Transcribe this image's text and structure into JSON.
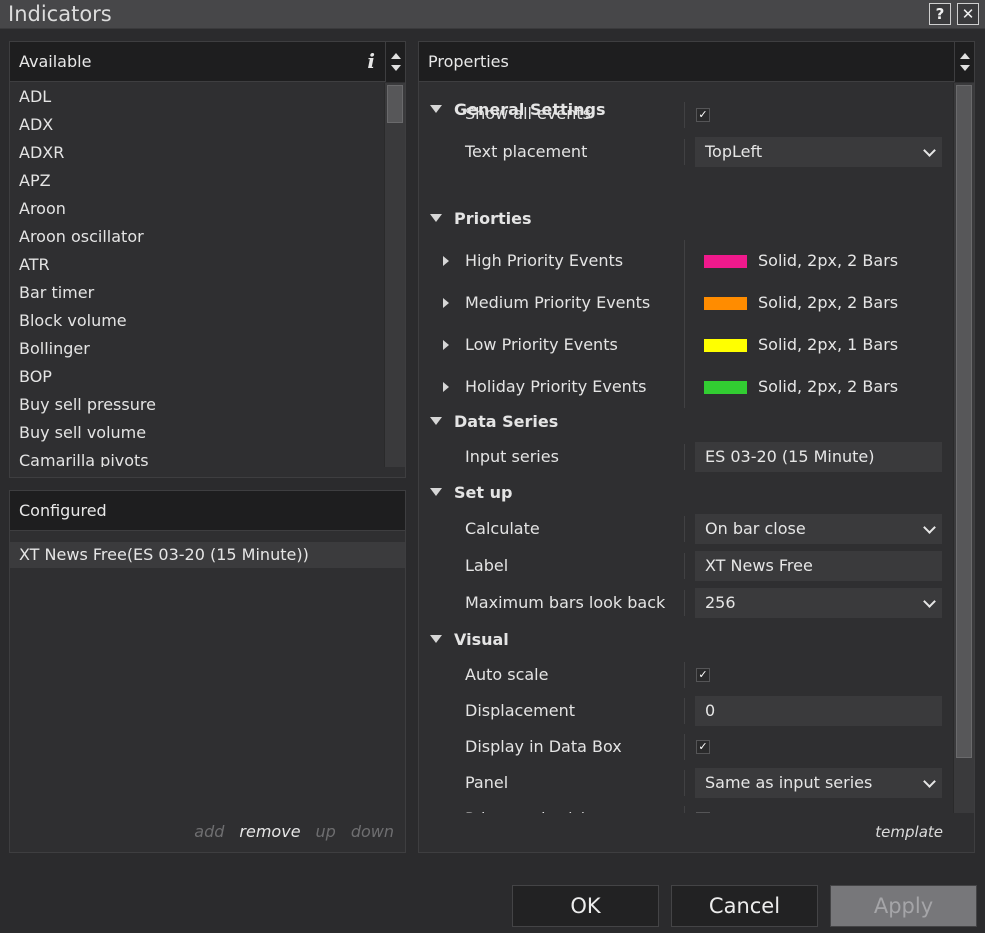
{
  "window": {
    "title": "Indicators",
    "help_label": "?",
    "close_label": "✕"
  },
  "available": {
    "header": "Available",
    "info_label": "i",
    "items": [
      "ADL",
      "ADX",
      "ADXR",
      "APZ",
      "Aroon",
      "Aroon oscillator",
      "ATR",
      "Bar timer",
      "Block volume",
      "Bollinger",
      "BOP",
      "Buy sell pressure",
      "Buy sell volume",
      "Camarilla pivots"
    ]
  },
  "configured": {
    "header": "Configured",
    "items": [
      "XT News Free(ES 03-20 (15 Minute))"
    ],
    "actions": {
      "add": "add",
      "remove": "remove",
      "up": "up",
      "down": "down"
    }
  },
  "properties": {
    "header": "Properties",
    "template_label": "template",
    "general": {
      "title": "General Settings",
      "show_all_events": {
        "label": "Show all events",
        "checked": true
      },
      "text_placement": {
        "label": "Text placement",
        "value": "TopLeft"
      }
    },
    "priorities": {
      "title": "Priorties",
      "items": [
        {
          "label": "High Priority Events",
          "color": "#f0198c",
          "value": "Solid, 2px, 2 Bars"
        },
        {
          "label": "Medium Priority Events",
          "color": "#ff8c00",
          "value": "Solid, 2px, 2 Bars"
        },
        {
          "label": "Low Priority Events",
          "color": "#ffff00",
          "value": "Solid, 2px, 1 Bars"
        },
        {
          "label": "Holiday Priority Events",
          "color": "#32cd32",
          "value": "Solid, 2px, 2 Bars"
        }
      ]
    },
    "data_series": {
      "title": "Data Series",
      "input_series": {
        "label": "Input series",
        "value": "ES 03-20 (15 Minute)"
      }
    },
    "setup": {
      "title": "Set up",
      "calculate": {
        "label": "Calculate",
        "value": "On bar close"
      },
      "label": {
        "label": "Label",
        "value": "XT News Free"
      },
      "max_bars": {
        "label": "Maximum bars look back",
        "value": "256"
      }
    },
    "visual": {
      "title": "Visual",
      "auto_scale": {
        "label": "Auto scale",
        "checked": true
      },
      "displacement": {
        "label": "Displacement",
        "value": "0"
      },
      "display_in_data_box": {
        "label": "Display in Data Box",
        "checked": true
      },
      "panel": {
        "label": "Panel",
        "value": "Same as input series"
      },
      "price_marker": {
        "label": "Price marker(s)",
        "checked": true
      }
    }
  },
  "buttons": {
    "ok": "OK",
    "cancel": "Cancel",
    "apply": "Apply"
  },
  "checkmark": "✓"
}
